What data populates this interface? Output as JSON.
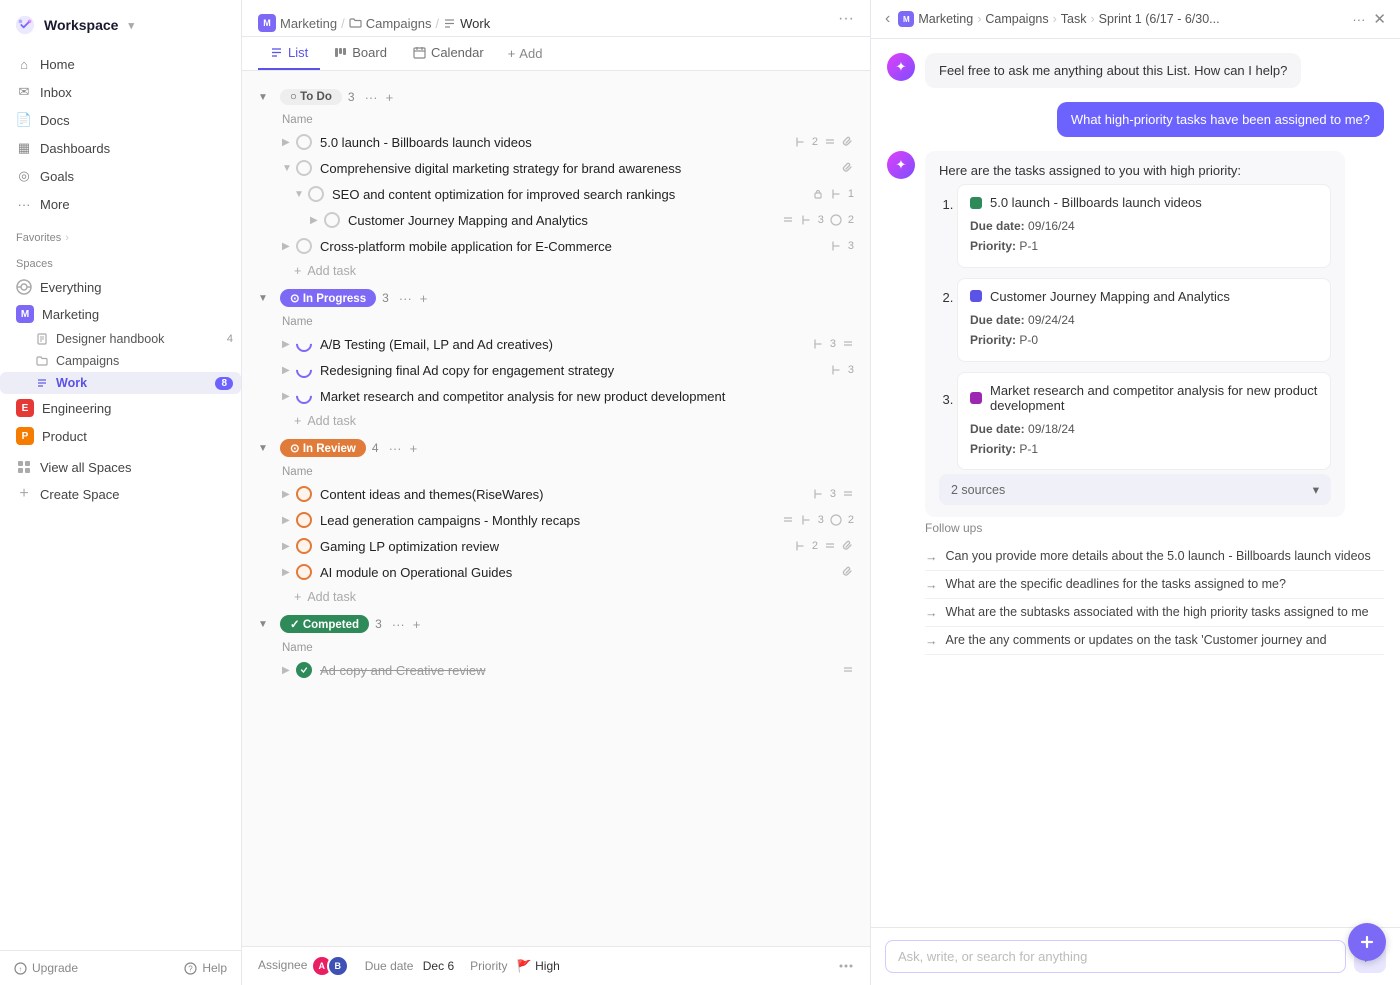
{
  "workspace": {
    "name": "Workspace",
    "chevron": "▾"
  },
  "sidebar": {
    "nav": [
      {
        "id": "home",
        "label": "Home",
        "icon": "⌂"
      },
      {
        "id": "inbox",
        "label": "Inbox",
        "icon": "✉"
      },
      {
        "id": "docs",
        "label": "Docs",
        "icon": "📄"
      },
      {
        "id": "dashboards",
        "label": "Dashboards",
        "icon": "▦"
      },
      {
        "id": "goals",
        "label": "Goals",
        "icon": "◎"
      },
      {
        "id": "more",
        "label": "More",
        "icon": "···"
      }
    ],
    "favorites_label": "Favorites",
    "favorites_chevron": "›",
    "spaces_label": "Spaces",
    "everything_label": "Everything",
    "spaces": [
      {
        "id": "marketing",
        "label": "Marketing",
        "color": "#7c6af7",
        "letter": "M",
        "bg": "#7c6af7"
      },
      {
        "id": "engineering",
        "label": "Engineering",
        "color": "#e53935",
        "letter": "E",
        "bg": "#e53935"
      },
      {
        "id": "product",
        "label": "Product",
        "color": "#f57c00",
        "letter": "P",
        "bg": "#f57c00"
      }
    ],
    "marketing_subitems": [
      {
        "id": "designer-handbook",
        "label": "Designer handbook",
        "count": "4"
      },
      {
        "id": "campaigns",
        "label": "Campaigns",
        "icon": "📁"
      },
      {
        "id": "work",
        "label": "Work",
        "active": true,
        "count": "8"
      }
    ],
    "view_all_spaces": "View all Spaces",
    "create_space": "Create Space",
    "upgrade": "Upgrade",
    "help": "Help"
  },
  "topbar": {
    "breadcrumb_m": "M",
    "bc1": "Marketing",
    "bc2": "Campaigns",
    "bc3": "Work",
    "dots": "···"
  },
  "view_tabs": [
    {
      "id": "list",
      "label": "List",
      "active": true,
      "icon": "≡"
    },
    {
      "id": "board",
      "label": "Board",
      "icon": "⊞"
    },
    {
      "id": "calendar",
      "label": "Calendar",
      "icon": "📅"
    },
    {
      "id": "add",
      "label": "Add",
      "icon": "+"
    }
  ],
  "task_groups": [
    {
      "id": "todo",
      "label": "To Do",
      "status": "todo",
      "count": "3",
      "tasks": [
        {
          "id": "t1",
          "name": "5.0 launch - Billboards launch videos",
          "meta": "2 0",
          "indent": 0
        },
        {
          "id": "t2",
          "name": "Comprehensive digital marketing strategy for brand awareness",
          "meta": "",
          "indent": 0,
          "has_sub": true
        },
        {
          "id": "t3",
          "name": "SEO and content optimization for improved search rankings",
          "meta": "1",
          "indent": 1,
          "has_sub": true
        },
        {
          "id": "t4",
          "name": "Customer Journey Mapping and Analytics",
          "meta": "3 2",
          "indent": 2
        },
        {
          "id": "t5",
          "name": "Cross-platform mobile application for E-Commerce",
          "meta": "3",
          "indent": 0
        }
      ]
    },
    {
      "id": "inprogress",
      "label": "In Progress",
      "status": "inprogress",
      "count": "3",
      "tasks": [
        {
          "id": "t6",
          "name": "A/B Testing (Email, LP and Ad creatives)",
          "meta": "3",
          "indent": 0
        },
        {
          "id": "t7",
          "name": "Redesigning final Ad copy for engagement strategy",
          "meta": "3",
          "indent": 0
        },
        {
          "id": "t8",
          "name": "Market research and competitor analysis for new product development",
          "meta": "",
          "indent": 0
        }
      ]
    },
    {
      "id": "inreview",
      "label": "In Review",
      "status": "inreview",
      "count": "4",
      "tasks": [
        {
          "id": "t9",
          "name": "Content ideas and themes(RiseWares)",
          "meta": "3",
          "indent": 0
        },
        {
          "id": "t10",
          "name": "Lead generation campaigns - Monthly recaps",
          "meta": "3 2",
          "indent": 0
        },
        {
          "id": "t11",
          "name": "Gaming LP optimization review",
          "meta": "2 0",
          "indent": 0
        },
        {
          "id": "t12",
          "name": "AI module on Operational Guides",
          "meta": "",
          "indent": 0
        }
      ]
    },
    {
      "id": "completed",
      "label": "Competed",
      "status": "completed",
      "count": "3",
      "tasks": [
        {
          "id": "t13",
          "name": "Ad copy and Creative review",
          "meta": "",
          "indent": 0
        }
      ]
    }
  ],
  "ai_panel": {
    "header": {
      "m_icon": "M",
      "bc1": "Marketing",
      "bc2": "Campaigns",
      "bc3": "Task",
      "bc4": "Sprint 1 (6/17 - 6/30...",
      "dots": "···",
      "close": "✕",
      "back": "‹"
    },
    "initial_prompt": "Feel free to ask me anything about this List. How can I help?",
    "user_message": "What high-priority tasks have been assigned to me?",
    "ai_response_intro": "Here are the tasks assigned to you with high priority:",
    "ai_tasks": [
      {
        "num": "1",
        "title": "5.0 launch - Billboards launch videos",
        "dot_color": "#2e8a59",
        "due_label": "Due date:",
        "due": "09/16/24",
        "priority_label": "Priority:",
        "priority": "P-1"
      },
      {
        "num": "2",
        "title": "Customer Journey Mapping and Analytics",
        "dot_color": "#5b52e7",
        "due_label": "Due date:",
        "due": "09/24/24",
        "priority_label": "Priority:",
        "priority": "P-0"
      },
      {
        "num": "3",
        "title": "Market research and competitor analysis for new product development",
        "dot_color": "#9c27b0",
        "due_label": "Due date:",
        "due": "09/18/24",
        "priority_label": "Priority:",
        "priority": "P-1"
      }
    ],
    "sources_label": "2 sources",
    "sources_chevron": "▾",
    "followups_label": "Follow ups",
    "followups": [
      "Can you provide more details about the 5.0 launch - Billboards launch videos",
      "What are the specific deadlines for the tasks assigned to me?",
      "What are the subtasks associated with the high priority tasks assigned to me",
      "Are the any comments or updates on the task 'Customer journey and"
    ],
    "input_placeholder": "Ask, write, or search for anything",
    "send_icon": "➤"
  },
  "bottom_bar": {
    "assignee_label": "Assignee",
    "due_date_label": "Due date",
    "due_date_val": "Dec 6",
    "priority_label": "Priority",
    "priority_val": "High",
    "priority_icon": "🚩"
  }
}
